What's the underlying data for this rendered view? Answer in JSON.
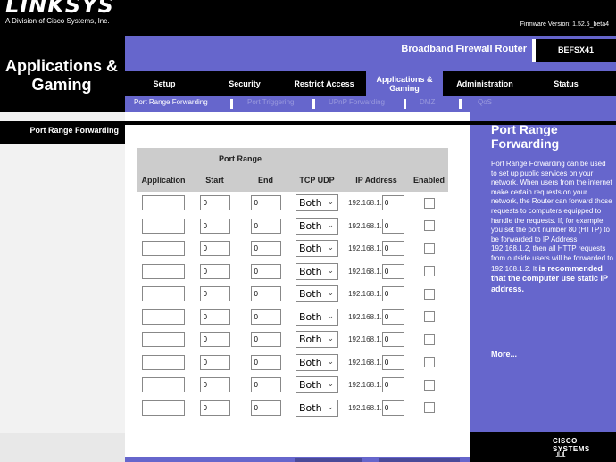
{
  "brand": {
    "logo": "LINKSYS",
    "subtitle": "A Division of Cisco Systems, Inc.",
    "firmware": "Firmware Version: 1.52.5_beta4"
  },
  "header": {
    "section_title": "Applications & Gaming",
    "product_name": "Broadband Firewall Router",
    "model": "BEFSX41"
  },
  "tabs": [
    {
      "label": "Setup"
    },
    {
      "label": "Security"
    },
    {
      "label": "Restrict Access"
    },
    {
      "label": "Applications & Gaming"
    },
    {
      "label": "Administration"
    },
    {
      "label": "Status"
    }
  ],
  "subtabs": [
    {
      "label": "Port Range Forwarding"
    },
    {
      "label": "Port Triggering"
    },
    {
      "label": "UPnP Forwarding"
    },
    {
      "label": "DMZ"
    },
    {
      "label": "QoS"
    }
  ],
  "left": {
    "label": "Port Range Forwarding"
  },
  "table": {
    "group_header": "Port Range",
    "columns": {
      "application": "Application",
      "start": "Start",
      "end": "End",
      "protocol": "TCP UDP",
      "ip": "IP Address",
      "enabled": "Enabled"
    },
    "ip_prefix": "192.168.1.",
    "rows": [
      {
        "application": "",
        "start": "0",
        "end": "0",
        "protocol": "Both",
        "ip": "0",
        "enabled": false
      },
      {
        "application": "",
        "start": "0",
        "end": "0",
        "protocol": "Both",
        "ip": "0",
        "enabled": false
      },
      {
        "application": "",
        "start": "0",
        "end": "0",
        "protocol": "Both",
        "ip": "0",
        "enabled": false
      },
      {
        "application": "",
        "start": "0",
        "end": "0",
        "protocol": "Both",
        "ip": "0",
        "enabled": false
      },
      {
        "application": "",
        "start": "0",
        "end": "0",
        "protocol": "Both",
        "ip": "0",
        "enabled": false
      },
      {
        "application": "",
        "start": "0",
        "end": "0",
        "protocol": "Both",
        "ip": "0",
        "enabled": false
      },
      {
        "application": "",
        "start": "0",
        "end": "0",
        "protocol": "Both",
        "ip": "0",
        "enabled": false
      },
      {
        "application": "",
        "start": "0",
        "end": "0",
        "protocol": "Both",
        "ip": "0",
        "enabled": false
      },
      {
        "application": "",
        "start": "0",
        "end": "0",
        "protocol": "Both",
        "ip": "0",
        "enabled": false
      },
      {
        "application": "",
        "start": "0",
        "end": "0",
        "protocol": "Both",
        "ip": "0",
        "enabled": false
      }
    ]
  },
  "help": {
    "title": "Port Range Forwarding",
    "body": "Port Range Forwarding can be used to set up public services on your network. When users from the internet make certain requests on your network, the Router can forward those requests to computers equipped to handle the requests. If, for example, you set the port number 80 (HTTP) to be forwarded to IP Address 192.168.1.2, then all HTTP requests from outside users will be forwarded to 192.168.1.2. It",
    "bold": "is recommended that the computer use static IP address.",
    "more": "More..."
  },
  "footer": {
    "cisco": "CISCO SYSTEMS"
  },
  "colors": {
    "purple": "#6666cc",
    "black": "#000000",
    "table_header": "#cccccc"
  }
}
